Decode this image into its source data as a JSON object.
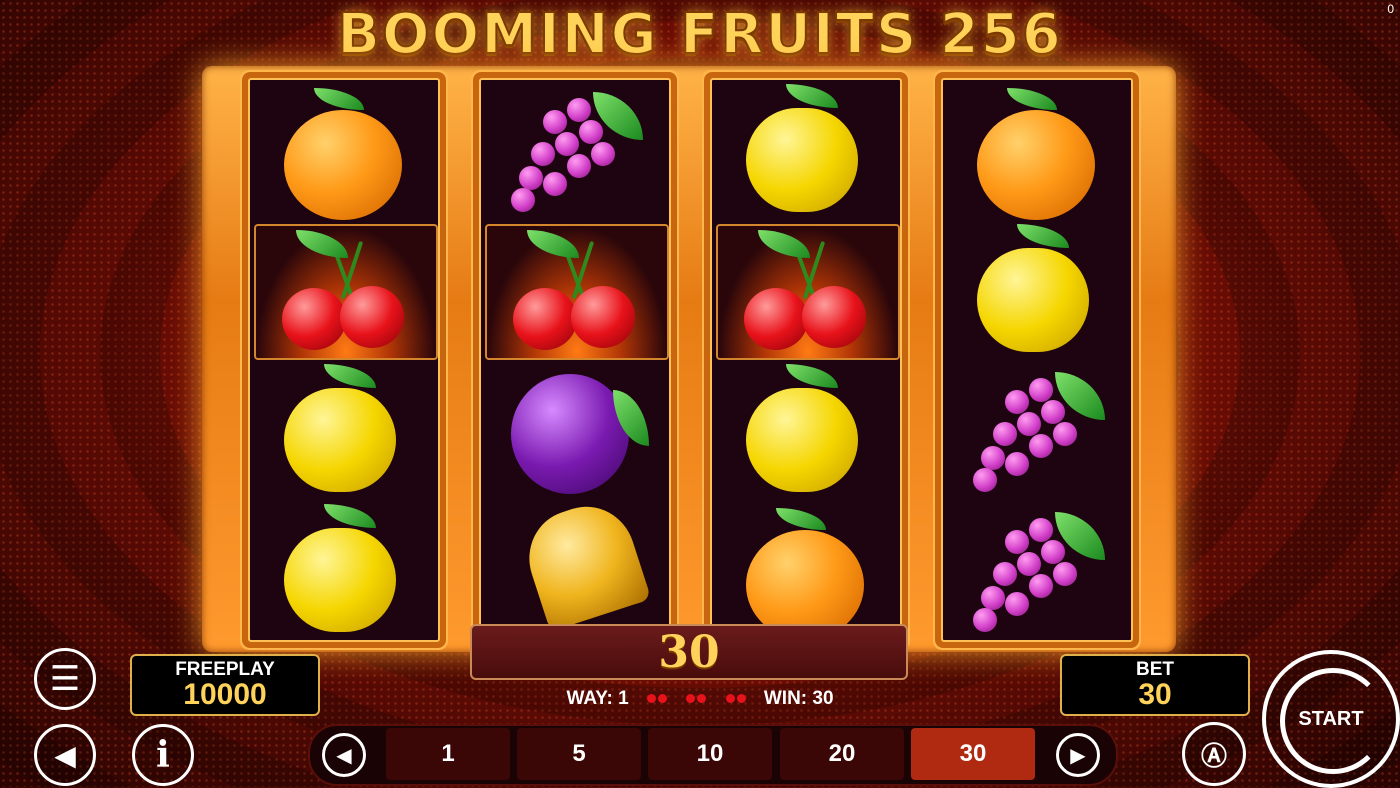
{
  "title": "BOOMING FRUITS 256",
  "corner_counter": "0",
  "reels": [
    {
      "symbols": [
        "orange-icon",
        "cherry-icon",
        "lemon-icon",
        "lemon-icon"
      ],
      "win_row": 1
    },
    {
      "symbols": [
        "grapes-icon",
        "cherry-icon",
        "plum-icon",
        "bell-icon"
      ],
      "win_row": 1
    },
    {
      "symbols": [
        "lemon-icon",
        "cherry-icon",
        "lemon-icon",
        "orange-icon"
      ],
      "win_row": 1
    },
    {
      "symbols": [
        "orange-icon",
        "lemon-icon",
        "grapes-icon",
        "grapes-icon"
      ],
      "win_row": null
    }
  ],
  "win_amount": "30",
  "way": {
    "label": "WAY: 1",
    "win": "WIN: 30"
  },
  "freeplay": {
    "label": "FREEPLAY",
    "value": "10000"
  },
  "bet": {
    "label": "BET",
    "value": "30"
  },
  "bet_options": [
    "1",
    "5",
    "10",
    "20",
    "30"
  ],
  "selected_bet": "30",
  "start_label": "START",
  "colors": {
    "accent": "#ffd35a",
    "frame": "#e67b14",
    "selected_bet": "#b02a12"
  }
}
